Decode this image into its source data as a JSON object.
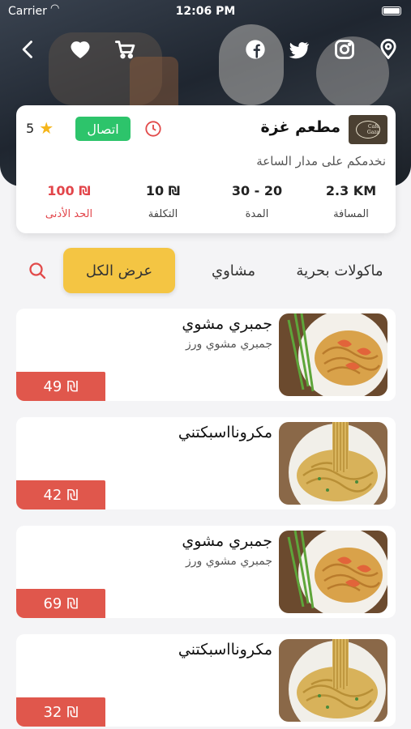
{
  "status": {
    "carrier": "Carrier",
    "time": "12:06 PM"
  },
  "restaurant": {
    "name": "مطعم غزة",
    "logo_text": "Cafe Gaza",
    "tagline": "نخدمكم على مدار الساعة",
    "call_label": "اتصال",
    "rating": "5"
  },
  "stats": [
    {
      "value": "2.3 KM",
      "label": "المسافة"
    },
    {
      "value": "30 - 20",
      "label": "المدة"
    },
    {
      "value": "10 ₪",
      "label": "التكلفة"
    },
    {
      "value": "100 ₪",
      "label": "الحد الأدنى"
    }
  ],
  "tabs": [
    {
      "label": "ماكولات بحرية",
      "active": false
    },
    {
      "label": "مشاوي",
      "active": false
    },
    {
      "label": "عرض الكل",
      "active": true
    }
  ],
  "items": [
    {
      "name": "جمبري مشوي",
      "desc": "جمبري مشوي ورز",
      "price": "49",
      "image": "shrimp-noodles"
    },
    {
      "name": "مكرونااسبكتني",
      "desc": "",
      "price": "42",
      "image": "spaghetti"
    },
    {
      "name": "جمبري مشوي",
      "desc": "جمبري مشوي ورز",
      "price": "69",
      "image": "shrimp-noodles"
    },
    {
      "name": "مكرونااسبكتني",
      "desc": "",
      "price": "32",
      "image": "spaghetti"
    }
  ],
  "currency": "₪",
  "colors": {
    "accent_yellow": "#f4c543",
    "call_green": "#2dc46b",
    "price_red": "#e0574c",
    "alert_red": "#e2454a"
  }
}
